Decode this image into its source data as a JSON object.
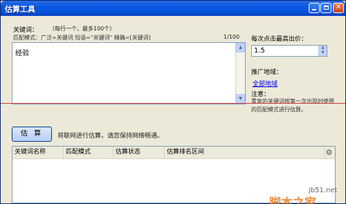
{
  "window": {
    "title": "估算工具"
  },
  "keywords": {
    "label": "关键词：",
    "hint": "（每行一个，最多100个）",
    "match_mode": "匹配模式：广泛=关键词  短语=\"关键词\"  精确=[关键词]",
    "count": "1/100",
    "value": "经验"
  },
  "bid": {
    "label": "每次点击最高出价：",
    "value": "1.5"
  },
  "region": {
    "label": "推广地域：",
    "link": "全部地域"
  },
  "note": {
    "label": "注意：",
    "text": "重复的关键词按第一次出现时使用的匹配模式进行估算。"
  },
  "estimate": {
    "button": "估 算",
    "hint": "将联网进行估算，请您保持网络畅通。"
  },
  "table": {
    "columns": [
      "关键词名称",
      "匹配模式",
      "估算状态",
      "估算排名区间"
    ]
  },
  "watermark": {
    "text": "脚本之家",
    "url": "jb51.net"
  }
}
